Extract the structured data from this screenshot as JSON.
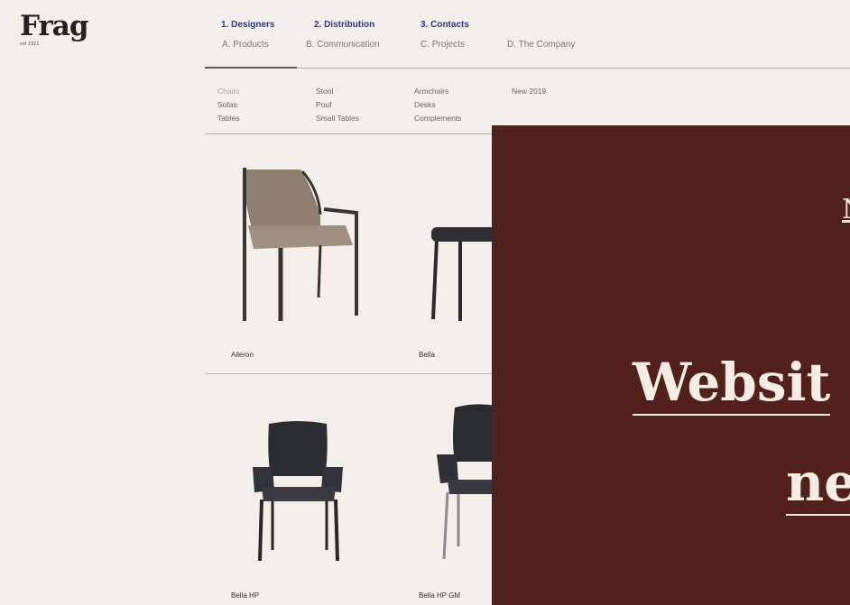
{
  "brand": {
    "name": "Frag",
    "tagline": "est 1921"
  },
  "nav": {
    "primary": [
      "1. Designers",
      "2. Distribution",
      "3. Contacts"
    ],
    "secondary": [
      "A. Products",
      "B. Communication",
      "C. Projects",
      "D. The Company"
    ]
  },
  "subnav": {
    "col1": [
      "Chairs",
      "Sofas",
      "Tables"
    ],
    "col2": [
      "Stool",
      "Pouf",
      "Small Tables"
    ],
    "col3": [
      "Armchairs",
      "Desks",
      "Complements"
    ],
    "col4": [
      "New 2019"
    ]
  },
  "products": [
    "Aileron",
    "Bella",
    "Bella HP",
    "Bella HP GM"
  ],
  "overlay": {
    "link_fragment": "N",
    "headline_1": "Websit",
    "headline_2": "ne"
  },
  "colors": {
    "background": "#f2eeea",
    "overlay": "#52211b",
    "nav_primary": "#2c3a8c",
    "overlay_text": "#f5ede3"
  }
}
